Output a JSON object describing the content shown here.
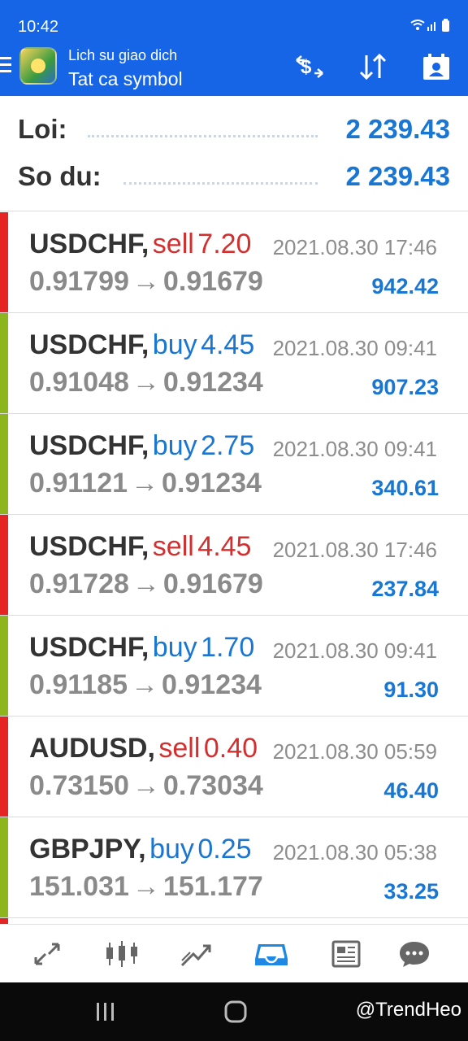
{
  "status": {
    "time": "10:42",
    "icons": "wifi-icon signal-icon battery-icon"
  },
  "header": {
    "subtitle": "Lich su giao dich",
    "title": "Tat ca symbol"
  },
  "summary": {
    "profit_label": "Loi:",
    "profit_value": "2 239.43",
    "balance_label": "So du:",
    "balance_value": "2 239.43"
  },
  "colors": {
    "accent": "#1565e6",
    "blue_text": "#1976d2",
    "sell": "#d32f2f",
    "buy_bar": "#8db61e",
    "sell_bar": "#e52424"
  },
  "trades": [
    {
      "symbol": "USDCHF,",
      "side": "sell",
      "volume": "7.20",
      "time": "2021.08.30 17:46",
      "open": "0.91799",
      "close": "0.91679",
      "profit": "942.42"
    },
    {
      "symbol": "USDCHF,",
      "side": "buy",
      "volume": "4.45",
      "time": "2021.08.30 09:41",
      "open": "0.91048",
      "close": "0.91234",
      "profit": "907.23"
    },
    {
      "symbol": "USDCHF,",
      "side": "buy",
      "volume": "2.75",
      "time": "2021.08.30 09:41",
      "open": "0.91121",
      "close": "0.91234",
      "profit": "340.61"
    },
    {
      "symbol": "USDCHF,",
      "side": "sell",
      "volume": "4.45",
      "time": "2021.08.30 17:46",
      "open": "0.91728",
      "close": "0.91679",
      "profit": "237.84"
    },
    {
      "symbol": "USDCHF,",
      "side": "buy",
      "volume": "1.70",
      "time": "2021.08.30 09:41",
      "open": "0.91185",
      "close": "0.91234",
      "profit": "91.30"
    },
    {
      "symbol": "AUDUSD,",
      "side": "sell",
      "volume": "0.40",
      "time": "2021.08.30 05:59",
      "open": "0.73150",
      "close": "0.73034",
      "profit": "46.40"
    },
    {
      "symbol": "GBPJPY,",
      "side": "buy",
      "volume": "0.25",
      "time": "2021.08.30 05:38",
      "open": "151.031",
      "close": "151.177",
      "profit": "33.25"
    }
  ],
  "arrow": "→",
  "watermark": "@TrendHeo"
}
